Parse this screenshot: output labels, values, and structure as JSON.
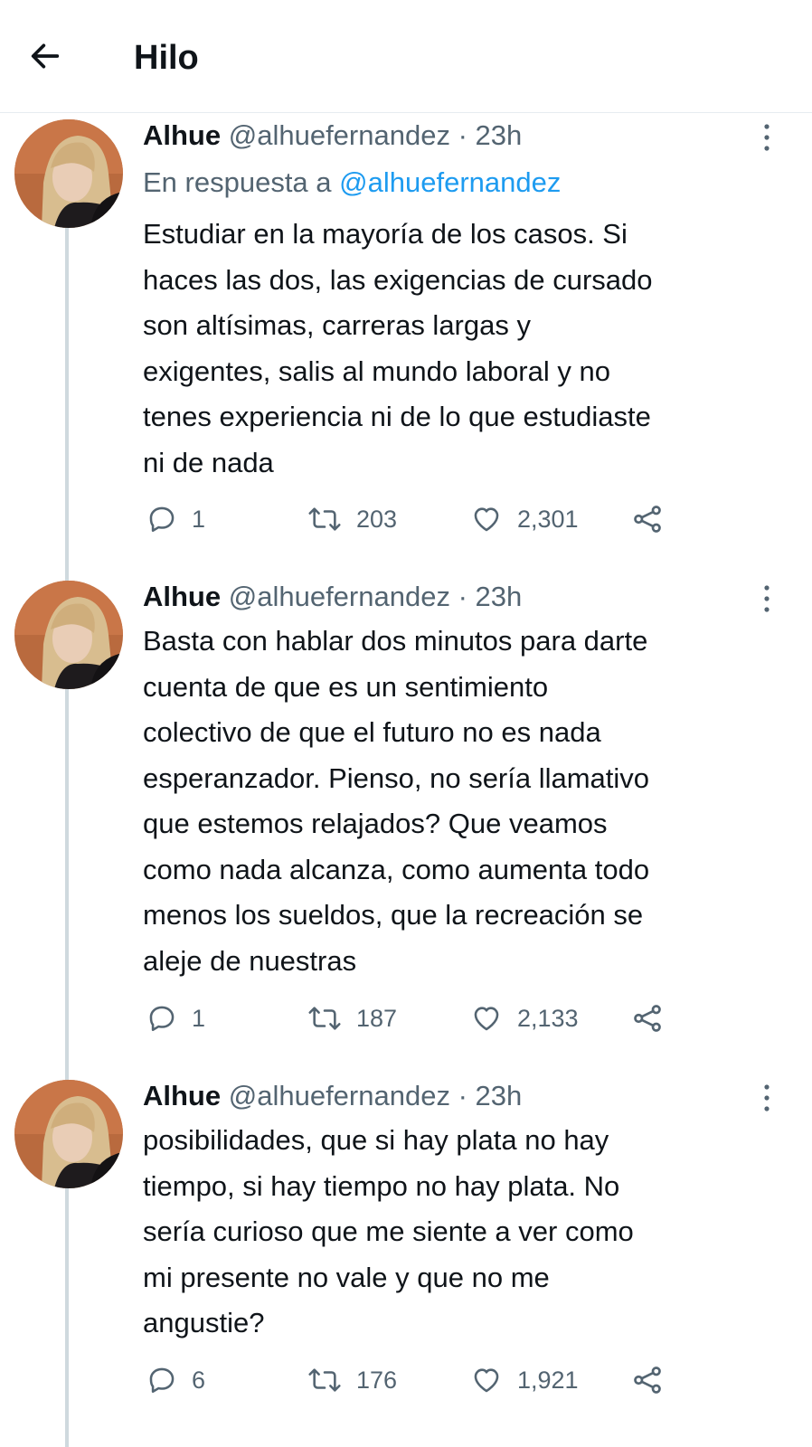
{
  "header": {
    "title": "Hilo"
  },
  "tweets": [
    {
      "name": "Alhue",
      "handle": "@alhuefernandez",
      "separator": "·",
      "time": "23h",
      "reply_prefix": "En respuesta a",
      "reply_mention": "@alhuefernandez",
      "text": "Estudiar en la mayoría de los casos.  Si\nhaces las dos, las exigencias de cursado\nson altísimas, carreras largas y\nexigentes, salis al mundo laboral y no\ntenes experiencia ni de lo que estudiaste\nni de nada",
      "replies": "1",
      "retweets": "203",
      "likes": "2,301"
    },
    {
      "name": "Alhue",
      "handle": "@alhuefernandez",
      "separator": "·",
      "time": "23h",
      "text": "Basta con hablar dos minutos para darte\ncuenta de que es un sentimiento\ncolectivo de que el futuro no es nada\nesperanzador. Pienso, no sería llamativo\nque estemos relajados? Que veamos\ncomo nada alcanza, como aumenta todo\nmenos los sueldos, que la recreación se\naleje de nuestras",
      "replies": "1",
      "retweets": "187",
      "likes": "2,133"
    },
    {
      "name": "Alhue",
      "handle": "@alhuefernandez",
      "separator": "·",
      "time": "23h",
      "text": "posibilidades, que si hay plata no hay\ntiempo, si hay tiempo no hay plata. No\nsería curioso que me siente a ver como\nmi presente no vale y que no me\nangustie?",
      "replies": "6",
      "retweets": "176",
      "likes": "1,921"
    }
  ],
  "icons": {
    "back": "arrow-left-icon",
    "more": "more-vertical-icon",
    "reply": "reply-bubble-icon",
    "retweet": "retweet-icon",
    "like": "heart-icon",
    "share": "share-icon"
  },
  "colors": {
    "text": "#0f1419",
    "secondary": "#536471",
    "mention": "#1d9bf0",
    "thread_line": "#cfd9de",
    "divider": "#e6ecf0"
  }
}
